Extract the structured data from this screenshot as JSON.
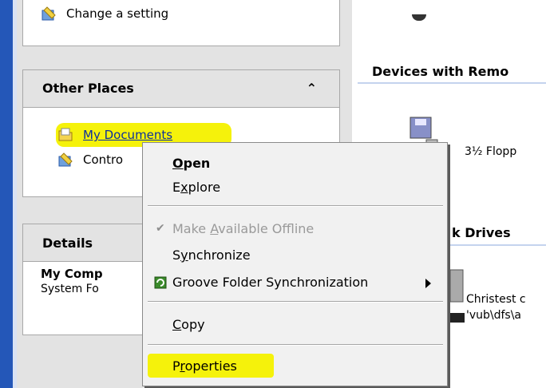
{
  "task_pane": {
    "top_link": "Change a setting",
    "other_places": {
      "title": "Other Places",
      "items": [
        "My Documents",
        "Contro"
      ]
    },
    "details": {
      "title": "Details",
      "name": "My Comp",
      "type": "System Fo"
    }
  },
  "right_pane": {
    "sections": [
      "Devices with Remo",
      "k Drives"
    ],
    "devices": [
      "3½ Flopp",
      "Christest c",
      "'vub\\dfs\\a"
    ]
  },
  "context_menu": {
    "items": [
      {
        "label": "Open",
        "access_key": "O"
      },
      {
        "label": "Explore",
        "access_key": "x"
      },
      {
        "label": "Make Available Offline",
        "access_key": "A",
        "enabled": false,
        "checked": true
      },
      {
        "label": "Synchronize",
        "access_key": "y"
      },
      {
        "label": "Groove Folder Synchronization",
        "has_submenu": true
      },
      {
        "label": "Copy",
        "access_key": "C"
      },
      {
        "label": "Properties",
        "access_key": "r"
      }
    ]
  },
  "colors": {
    "highlight": "#f5f20b",
    "link": "#0b2f9e",
    "accent_strip": "#2457b8"
  }
}
